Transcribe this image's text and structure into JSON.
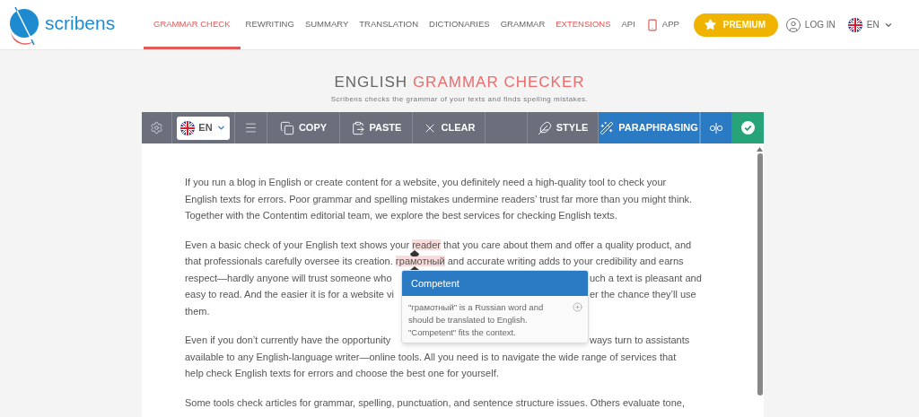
{
  "header": {
    "logo_text": "scribens",
    "nav": [
      {
        "label": "GRAMMAR CHECK",
        "selected": true,
        "kind": "link"
      },
      {
        "label": "REWRITING",
        "selected": false,
        "kind": "link"
      },
      {
        "label": "SUMMARY",
        "selected": false,
        "kind": "link"
      },
      {
        "label": "TRANSLATION",
        "selected": false,
        "kind": "link"
      },
      {
        "label": "DICTIONARIES",
        "selected": false,
        "kind": "link"
      },
      {
        "label": "GRAMMAR",
        "selected": false,
        "kind": "link"
      },
      {
        "label": "EXTENSIONS",
        "selected": false,
        "kind": "highlight"
      },
      {
        "label": "API",
        "selected": false,
        "kind": "link"
      },
      {
        "label": "APP",
        "selected": false,
        "kind": "app"
      }
    ],
    "premium": "PREMIUM",
    "login": "LOG IN",
    "language": "EN"
  },
  "heading": {
    "plain": "ENGLISH",
    "accent": "GRAMMAR CHECKER",
    "subtitle": "Scribens checks the grammar of your texts and finds spelling mistakes."
  },
  "toolbar": [
    {
      "kind": "settings"
    },
    {
      "kind": "language",
      "label": "EN"
    },
    {
      "kind": "menu"
    },
    {
      "kind": "copy",
      "label": "COPY"
    },
    {
      "kind": "paste",
      "label": "PASTE"
    },
    {
      "kind": "clear",
      "label": "CLEAR"
    },
    {
      "kind": "blank"
    },
    {
      "kind": "style",
      "label": "STYLE"
    },
    {
      "kind": "paraphrasing",
      "label": "PARAPHRASING"
    },
    {
      "kind": "split"
    },
    {
      "kind": "check"
    }
  ],
  "editor": {
    "paragraphs": [
      {
        "lines": [
          {
            "segments": [
              {
                "kind": "plain",
                "text": "If you run a blog in English or create content for a website, you definitely need a high-quality tool to check your"
              }
            ]
          },
          {
            "segments": [
              {
                "kind": "plain",
                "text": "English texts for errors. Poor grammar and spelling mistakes undermine readers’ trust far more than you might think."
              }
            ]
          },
          {
            "segments": [
              {
                "kind": "plain",
                "text": "Together with the Contentim editorial team, we explore the best services for checking English texts."
              }
            ]
          }
        ]
      },
      {
        "lines": [
          {
            "segments": [
              {
                "kind": "plain",
                "text": "Even a basic check of your English text shows your "
              },
              {
                "kind": "error",
                "text": "reader"
              },
              {
                "kind": "plain",
                "text": " that you care about them and offer a quality product, and"
              }
            ]
          },
          {
            "segments": [
              {
                "kind": "plain",
                "text": "that professionals carefully oversee its creation. "
              },
              {
                "kind": "error",
                "text": "грамотный"
              },
              {
                "kind": "plain",
                "text": " and accurate writing adds to your credibility and earns"
              }
            ]
          },
          {
            "segments": [
              {
                "kind": "plain",
                "text": "respect—hardly anyone will trust someone who"
              }
            ],
            "right": "uch a text is pleasant and"
          },
          {
            "segments": [
              {
                "kind": "plain",
                "text": "easy to read. And the easier it is for a website vi"
              }
            ],
            "right": "er the chance they’ll use"
          },
          {
            "segments": [
              {
                "kind": "plain",
                "text": "them."
              }
            ]
          }
        ]
      },
      {
        "lines": [
          {
            "segments": [
              {
                "kind": "plain",
                "text": "Even if you don’t currently have the opportunity"
              }
            ],
            "right": "ways turn to assistants"
          },
          {
            "segments": [
              {
                "kind": "plain",
                "text": "available to any English-language writer—online tools. All you need is to navigate the wide range of services that"
              }
            ]
          },
          {
            "segments": [
              {
                "kind": "plain",
                "text": "help check English texts for errors and choose the best one for yourself."
              }
            ]
          }
        ]
      },
      {
        "lines": [
          {
            "segments": [
              {
                "kind": "plain",
                "text": "Some tools check articles for grammar, spelling, punctuation, and sentence structure issues. Others evaluate tone,"
              }
            ]
          }
        ]
      }
    ],
    "popup": {
      "title": "Competent",
      "message": "\"грамотный\" is a Russian word and should be translated to English. \"Competent\" fits the context."
    }
  }
}
